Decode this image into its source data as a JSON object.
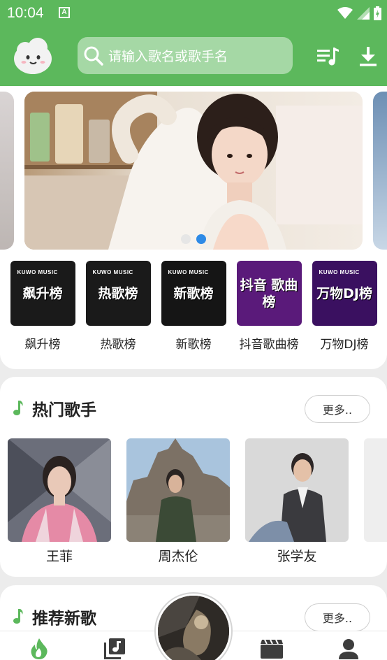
{
  "status_bar": {
    "time": "10:04",
    "badge": "A",
    "icons": [
      "wifi-icon",
      "signal-icon",
      "battery-icon"
    ]
  },
  "header": {
    "search_placeholder": "请输入歌名或歌手名",
    "logo": "cloud-mascot-logo",
    "buttons": [
      "playlist-icon",
      "download-icon"
    ]
  },
  "banner": {
    "slides": 2,
    "active_slide": 2
  },
  "charts": [
    {
      "label": "飙升榜",
      "brand": "KUWO MUSIC",
      "tile_text": "飙升榜",
      "bg": "#1a1a1a"
    },
    {
      "label": "热歌榜",
      "brand": "KUWO MUSIC",
      "tile_text": "热歌榜",
      "bg": "#1a1a1a"
    },
    {
      "label": "新歌榜",
      "brand": "KUWO MUSIC",
      "tile_text": "新歌榜",
      "bg": "#151515"
    },
    {
      "label": "抖音歌曲榜",
      "brand": "",
      "tile_text": "抖音 歌曲榜",
      "bg": "#5a1a7a"
    },
    {
      "label": "万物DJ榜",
      "brand": "KUWO MUSIC",
      "tile_text": "万物DJ榜",
      "bg": "#3a1060"
    }
  ],
  "hot_singers": {
    "title": "热门歌手",
    "more": "更多..",
    "singers": [
      {
        "name": "王菲"
      },
      {
        "name": "周杰伦"
      },
      {
        "name": "张学友"
      }
    ]
  },
  "new_songs": {
    "title": "推荐新歌",
    "more": "更多.."
  },
  "nav": {
    "items": [
      "home-flame-icon",
      "music-library-icon",
      "player-disc",
      "video-icon",
      "profile-icon"
    ]
  },
  "colors": {
    "primary": "#5cb85c",
    "active_dot": "#2e8ae6"
  }
}
